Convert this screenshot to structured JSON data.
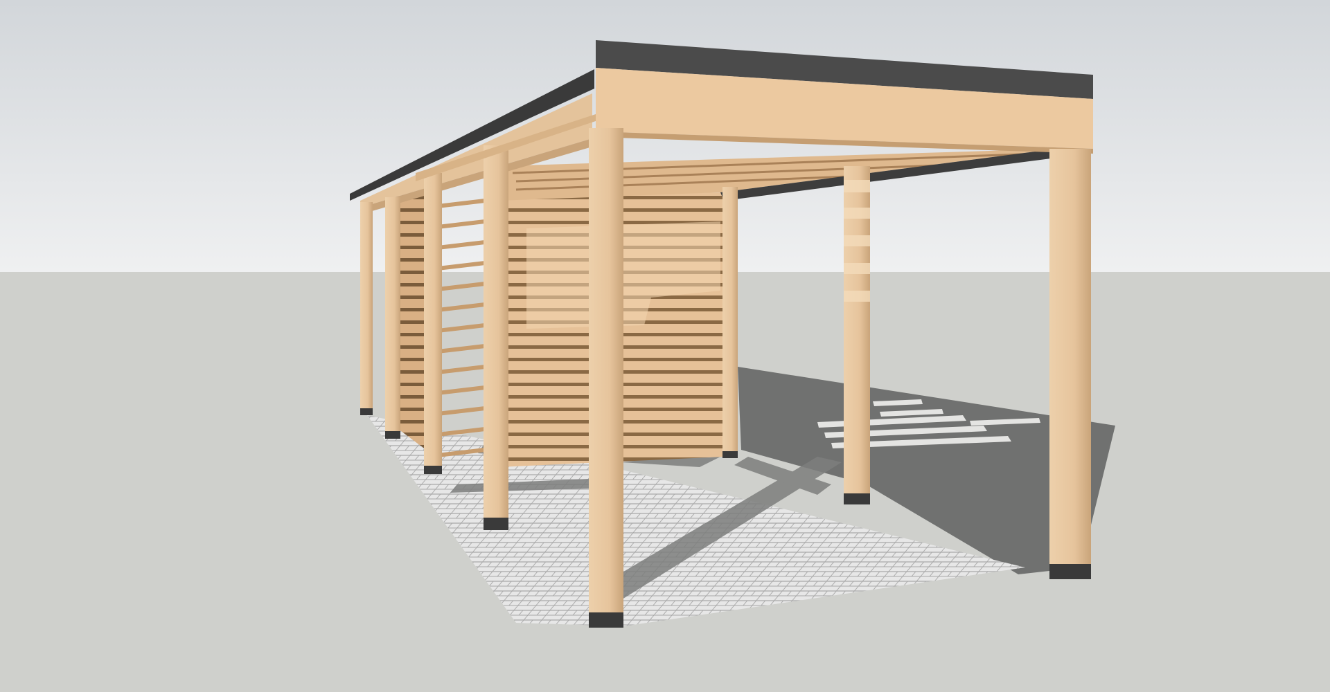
{
  "scene": {
    "subject": "carport-3d-model",
    "palette": {
      "sky_top": "#d2d6da",
      "sky_bottom": "#eff0f1",
      "ground": "#cfd0cc",
      "roof_dark": "#4a4a4a",
      "roof_edge": "#2c2c2c",
      "wood_light": "#eccba4",
      "wood_mid": "#e0b98e",
      "wood_shadow": "#b99368",
      "wood_line": "#6e5236",
      "post_foot": "#3a3a3a",
      "paving": "#e6e6e6",
      "paving_line": "#a9a9a9",
      "cast_shadow": "#6f706f"
    }
  }
}
